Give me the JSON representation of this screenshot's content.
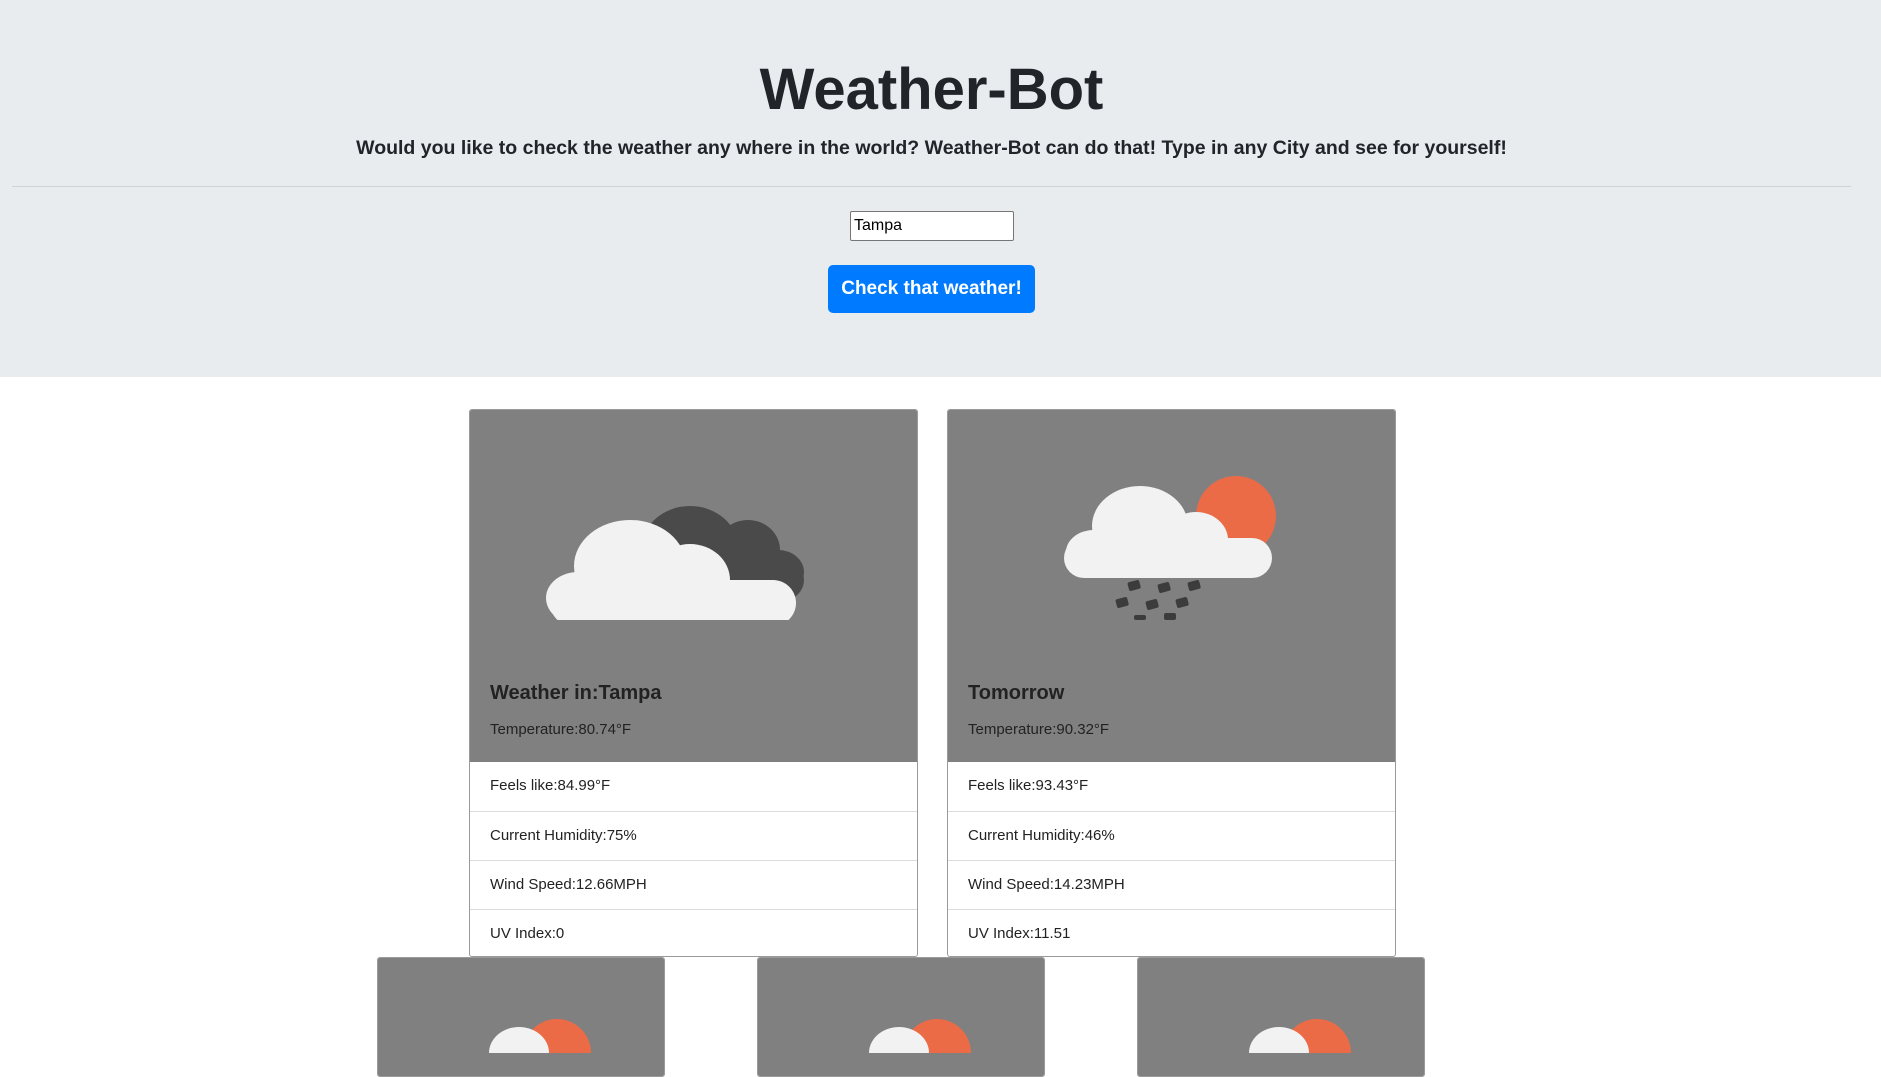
{
  "header": {
    "title": "Weather-Bot",
    "lead": "Would you like to check the weather any where in the world? Weather-Bot can do that! Type in any City and see for yourself!"
  },
  "search": {
    "value": "Tampa",
    "button_label": "Check that weather!"
  },
  "cards": [
    {
      "title": "Weather in:Tampa",
      "icon": "cloudy-icon",
      "temperature": "Temperature:80.74°F",
      "feels_like": "Feels like:84.99°F",
      "humidity": "Current Humidity:75%",
      "wind": "Wind Speed:12.66MPH",
      "uv": "UV Index:0"
    },
    {
      "title": "Tomorrow",
      "icon": "rain-sun-icon",
      "temperature": "Temperature:90.32°F",
      "feels_like": "Feels like:93.43°F",
      "humidity": "Current Humidity:46%",
      "wind": "Wind Speed:14.23MPH",
      "uv": "UV Index:11.51"
    }
  ],
  "forecast_cards": [
    {
      "icon": "partly-sunny-icon"
    },
    {
      "icon": "partly-sunny-icon"
    },
    {
      "icon": "partly-sunny-icon"
    }
  ],
  "colors": {
    "header_bg": "#e9ecef",
    "button": "#007bff",
    "card_top": "#808080",
    "cloud_light": "#f2f2f2",
    "cloud_dark": "#4a4a4a",
    "sun": "#ec6b47"
  }
}
